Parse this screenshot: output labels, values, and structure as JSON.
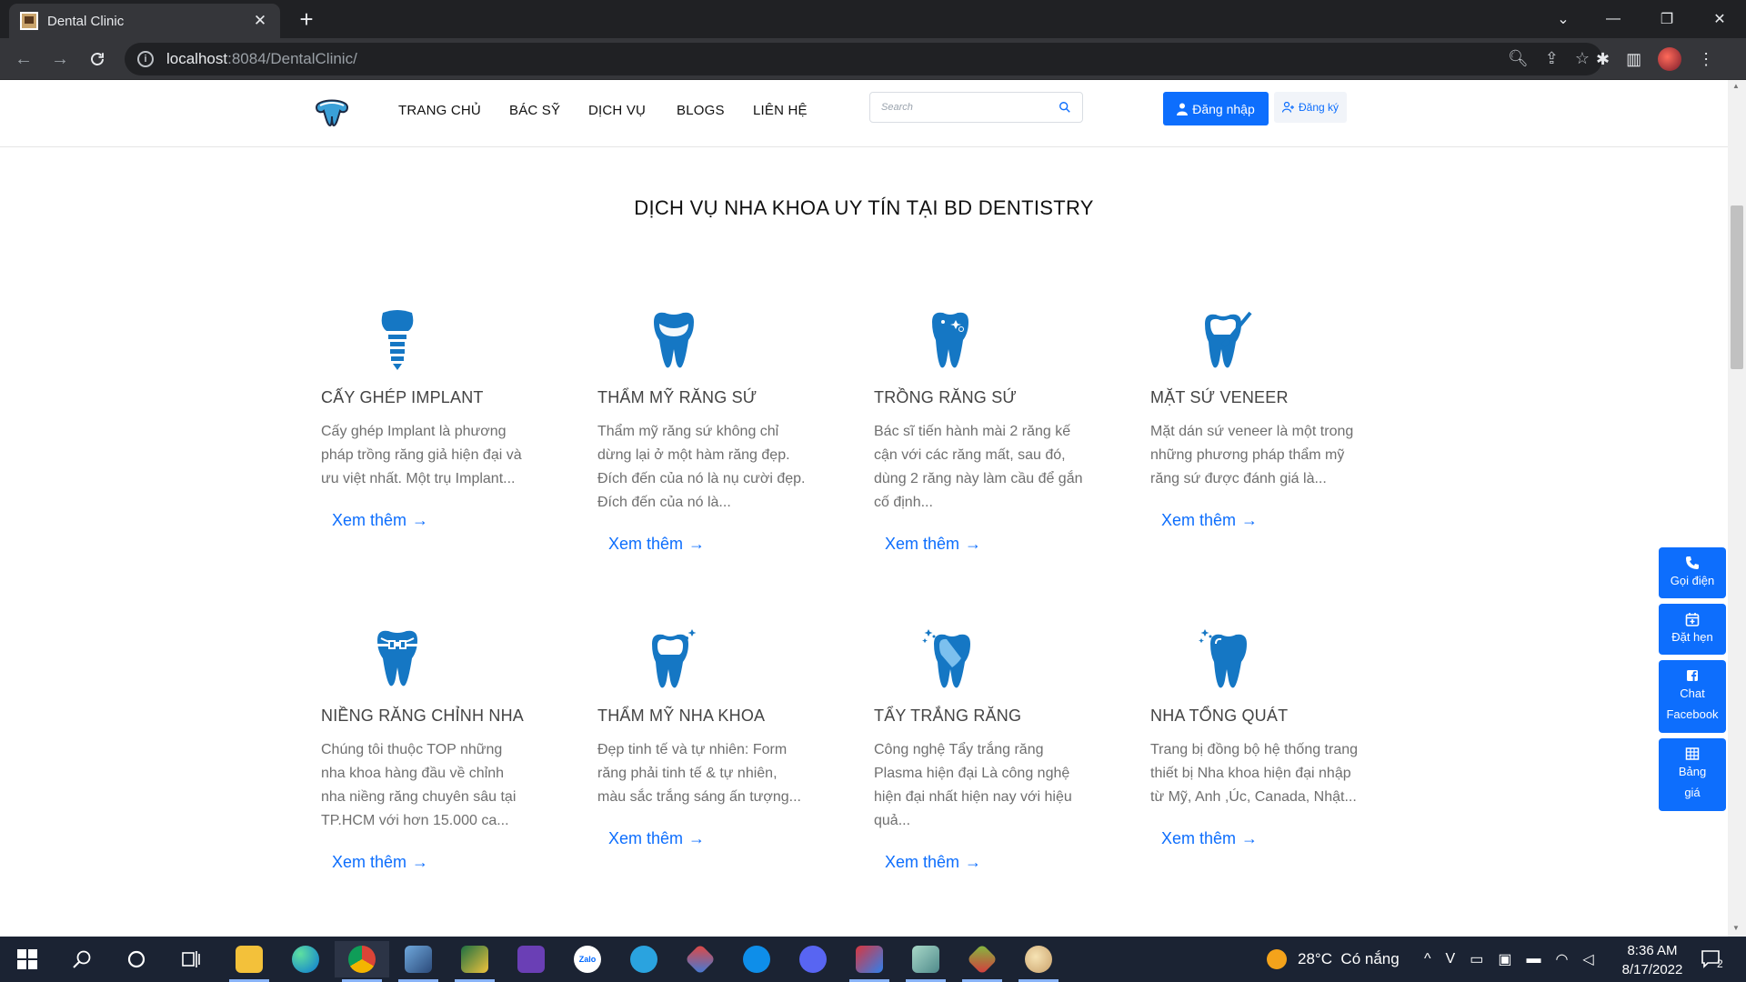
{
  "browser": {
    "tab_title": "Dental Clinic",
    "url_host": "localhost",
    "url_path": ":8084/DentalClinic/"
  },
  "navbar": {
    "links": [
      "TRANG CHỦ",
      "BÁC SỸ",
      "DỊCH VỤ",
      "BLOGS",
      "LIÊN HỆ"
    ],
    "search_placeholder": "Search",
    "login_label": "Đăng nhập",
    "register_label": "Đăng ký"
  },
  "section_title": "DỊCH VỤ NHA KHOA UY TÍN TẠI BD DENTISTRY",
  "services": [
    {
      "title": "CẤY GHÉP IMPLANT",
      "desc": "Cấy ghép Implant là phương pháp trồng răng giả hiện đại và ưu việt nhất. Một trụ Implant...",
      "more": "Xem thêm",
      "icon": "implant-icon"
    },
    {
      "title": "THẨM MỸ RĂNG SỨ",
      "desc": "Thẩm mỹ răng sứ không chỉ dừng lại ở một hàm răng đẹp. Đích đến của nó là nụ cười đẹp. Đích đến của nó là...",
      "more": "Xem thêm",
      "icon": "tooth-crown-icon"
    },
    {
      "title": "TRỒNG RĂNG SỨ",
      "desc": "Bác sĩ tiến hành mài 2 răng kế cận với các răng mất, sau đó, dùng 2 răng này làm cầu để gắn cố định...",
      "more": "Xem thêm",
      "icon": "tooth-sparkle-icon"
    },
    {
      "title": "MẶT SỨ VENEER",
      "desc": "Mặt dán sứ veneer là một trong những phương pháp thẩm mỹ răng sứ được đánh giá là...",
      "more": "Xem thêm",
      "icon": "tooth-brush-icon"
    },
    {
      "title": "NIỀNG RĂNG CHỈNH NHA",
      "desc": "Chúng tôi thuộc TOP những nha khoa hàng đầu về chỉnh nha niềng răng chuyên sâu tại TP.HCM với hơn 15.000 ca...",
      "more": "Xem thêm",
      "icon": "tooth-braces-icon"
    },
    {
      "title": "THẨM MỸ NHA KHOA",
      "desc": "Đẹp tinh tế và tự nhiên: Form răng phải tinh tế & tự nhiên, màu sắc trắng sáng ấn tượng...",
      "more": "Xem thêm",
      "icon": "tooth-shine-icon"
    },
    {
      "title": "TẨY TRẮNG RĂNG",
      "desc": "Công nghệ Tẩy trắng răng Plasma hiện đại Là công nghệ hiện đại nhất hiện nay với hiệu quả...",
      "more": "Xem thêm",
      "icon": "tooth-whitening-icon"
    },
    {
      "title": "NHA TỔNG QUÁT",
      "desc": "Trang bị đồng bộ hệ thống trang thiết bị Nha khoa hiện đại nhập từ Mỹ, Anh ,Úc, Canada, Nhật...",
      "more": "Xem thêm",
      "icon": "tooth-general-icon"
    }
  ],
  "floating": {
    "call": "Gọi điện",
    "book": "Đặt hẹn",
    "chat_line1": "Chat",
    "chat_line2": "Facebook",
    "price_line1": "Bảng",
    "price_line2": "giá"
  },
  "taskbar": {
    "weather": "28°C  Có nắng",
    "time": "8:36 AM",
    "date": "8/17/2022",
    "notification_count": "2",
    "zalo_label": "Zalo"
  },
  "colors": {
    "primary": "#0d6efd",
    "icon_blue": "#1577c4",
    "chrome_dark": "#202124",
    "taskbar": "#1b2333"
  }
}
